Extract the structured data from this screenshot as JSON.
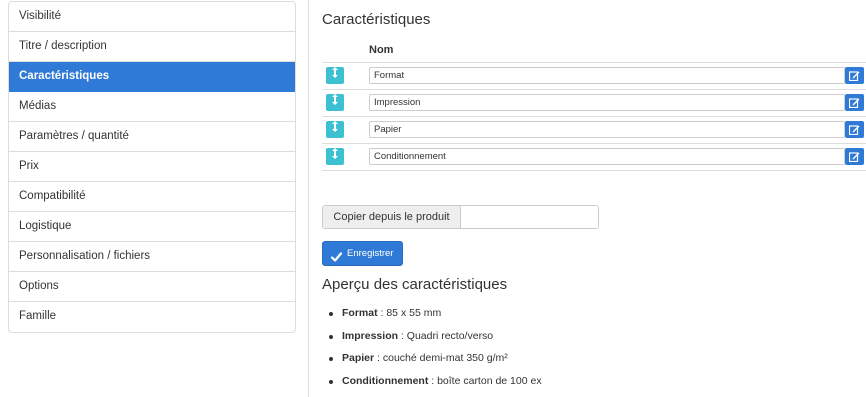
{
  "sidebar": {
    "items": [
      {
        "label": "Visibilité",
        "active": false
      },
      {
        "label": "Titre / description",
        "active": false
      },
      {
        "label": "Caractéristiques",
        "active": true
      },
      {
        "label": "Médias",
        "active": false
      },
      {
        "label": "Paramètres / quantité",
        "active": false
      },
      {
        "label": "Prix",
        "active": false
      },
      {
        "label": "Compatibilité",
        "active": false
      },
      {
        "label": "Logistique",
        "active": false
      },
      {
        "label": "Personnalisation / fichiers",
        "active": false
      },
      {
        "label": "Options",
        "active": false
      },
      {
        "label": "Famille",
        "active": false
      }
    ]
  },
  "main": {
    "title": "Caractéristiques",
    "column_header": "Nom",
    "characteristics": [
      {
        "value": "Format",
        "sort_icon": "sort-arrows-icon",
        "edit_icon": "edit-icon"
      },
      {
        "value": "Impression",
        "sort_icon": "sort-arrows-icon",
        "edit_icon": "edit-icon"
      },
      {
        "value": "Papier",
        "sort_icon": "sort-arrows-icon",
        "edit_icon": "edit-icon"
      },
      {
        "value": "Conditionnement",
        "sort_icon": "sort-arrows-icon",
        "edit_icon": "edit-icon"
      }
    ],
    "copy": {
      "label": "Copier depuis le produit",
      "value": ""
    },
    "save_label": "Enregistrer",
    "preview": {
      "title": "Aperçu des caractéristiques",
      "items": [
        {
          "key": "Format",
          "value": " : 85 x 55 mm"
        },
        {
          "key": "Impression",
          "value": " : Quadri recto/verso"
        },
        {
          "key": "Papier",
          "value": " : couché demi-mat 350 g/m²"
        },
        {
          "key": "Conditionnement",
          "value": " : boîte carton de 100 ex"
        }
      ]
    }
  },
  "colors": {
    "primary": "#2f7ad6",
    "info": "#3ec0d3",
    "border": "#dddddd"
  }
}
